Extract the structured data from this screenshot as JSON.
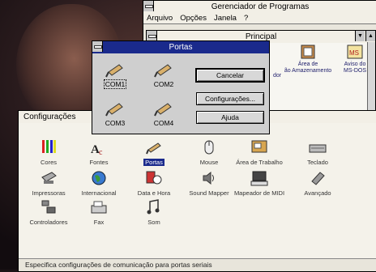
{
  "program_manager": {
    "title": "Gerenciador de Programas",
    "menu": [
      "Arquivo",
      "Opções",
      "Janela",
      "?"
    ],
    "group_title": "Principal",
    "icons": [
      {
        "label_line1": "dor",
        "label_line2": ""
      },
      {
        "label_line1": "Área de",
        "label_line2": "ão Amazenamento"
      },
      {
        "label_line1": "Aviso do",
        "label_line2": "MS-DOS"
      }
    ]
  },
  "control_panel": {
    "title": "Configurações",
    "icons": [
      {
        "label": "Cores",
        "icon": "color-pencils-icon"
      },
      {
        "label": "Fontes",
        "icon": "fonts-icon"
      },
      {
        "label": "Portas",
        "icon": "serial-port-icon",
        "selected": true
      },
      {
        "label": "Mouse",
        "icon": "mouse-icon"
      },
      {
        "label": "Área de Trabalho",
        "icon": "desktop-icon"
      },
      {
        "label": "Teclado",
        "icon": "keyboard-icon"
      },
      {
        "label": "Impressoras",
        "icon": "printer-icon"
      },
      {
        "label": "Internacional",
        "icon": "globe-icon"
      },
      {
        "label": "Data e Hora",
        "icon": "clock-calendar-icon"
      },
      {
        "label": "Sound Mapper",
        "icon": "speaker-icon"
      },
      {
        "label": "Mapeador de MIDI",
        "icon": "midi-icon"
      },
      {
        "label": "Avançado",
        "icon": "chip-icon"
      },
      {
        "label": "Controladores",
        "icon": "drivers-icon"
      },
      {
        "label": "Fax",
        "icon": "fax-icon"
      },
      {
        "label": "Som",
        "icon": "sound-icon"
      }
    ],
    "status": "Especifica configurações de comunicação para portas seriais"
  },
  "ports_dialog": {
    "title": "Portas",
    "ports": [
      "COM1",
      "COM2",
      "COM3",
      "COM4"
    ],
    "selected_port": "COM1",
    "buttons": {
      "cancel": "Cancelar",
      "settings": "Configurações...",
      "help": "Ajuda"
    }
  },
  "colors": {
    "active_title": "#1a2a8c",
    "selection": "#1a2a8c"
  }
}
